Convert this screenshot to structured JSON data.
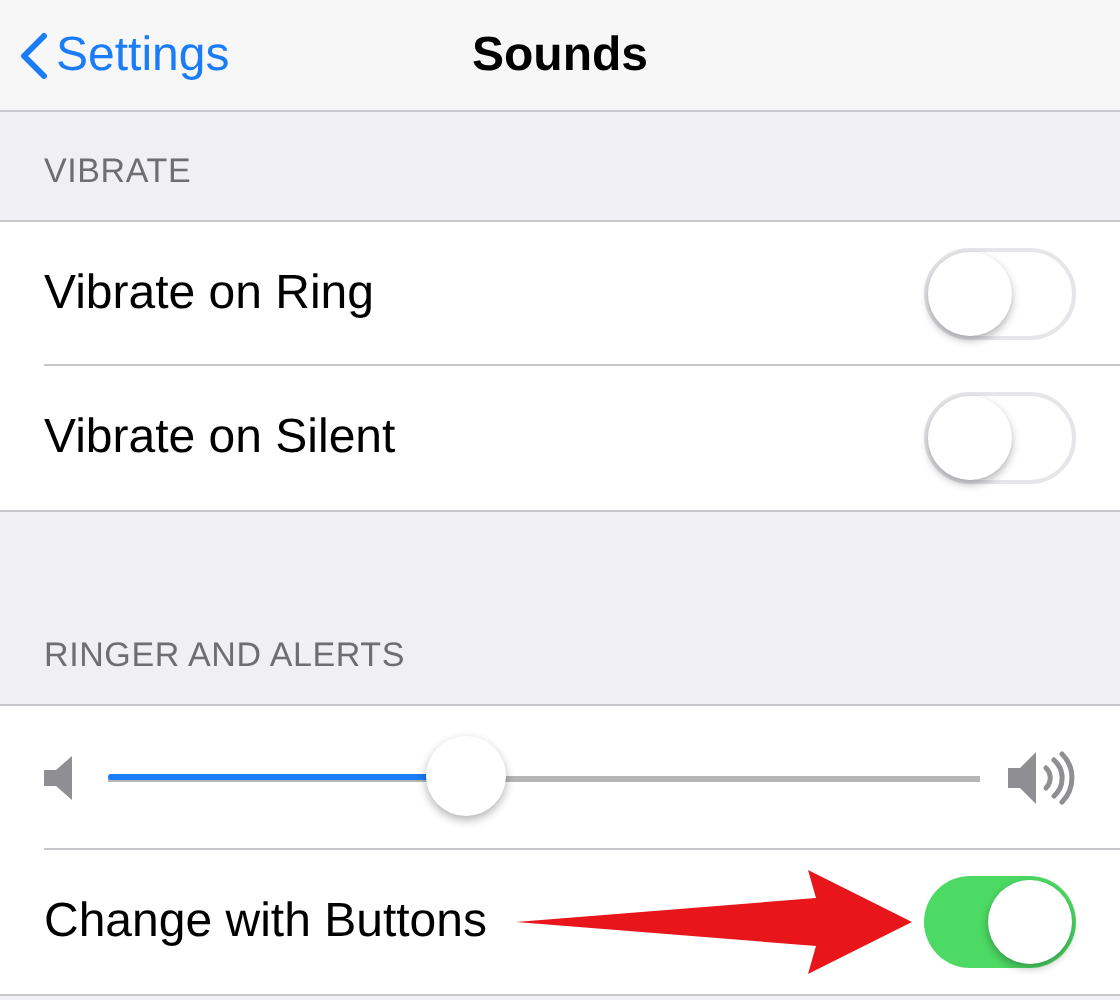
{
  "nav_bar": {
    "back_label": "Settings",
    "title": "Sounds"
  },
  "sections": [
    {
      "header": "VIBRATE",
      "rows": [
        {
          "kind": "toggle",
          "label": "Vibrate on Ring",
          "on": false
        },
        {
          "kind": "toggle",
          "label": "Vibrate on Silent",
          "on": false
        }
      ]
    },
    {
      "header": "RINGER AND ALERTS",
      "rows": [
        {
          "kind": "slider",
          "level": 0.41
        },
        {
          "kind": "toggle",
          "label": "Change with Buttons",
          "on": true,
          "annotated": true
        }
      ]
    }
  ]
}
